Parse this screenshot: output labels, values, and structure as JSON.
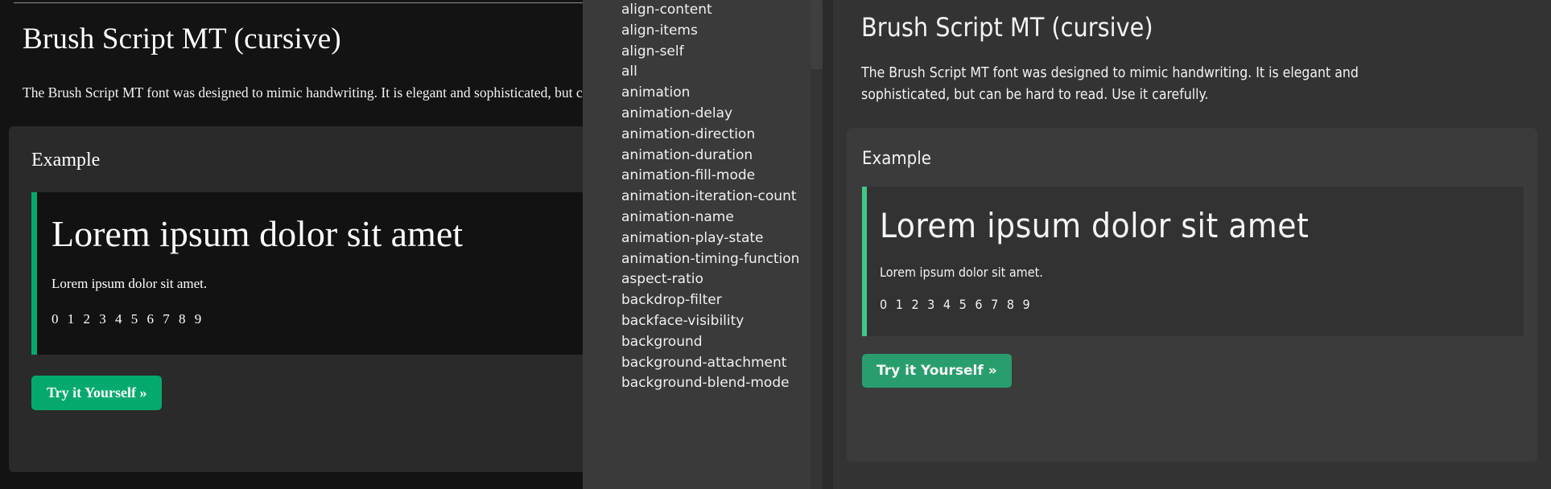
{
  "left_panel": {
    "heading": "Brush Script MT (cursive)",
    "intro": "The Brush Script MT font was designed to mimic handwriting. It is elegant and sophisticated, but can be hard to read. Use it carefully.",
    "example_label": "Example",
    "sample_heading": "Lorem ipsum dolor sit amet",
    "sample_paragraph": "Lorem ipsum dolor sit amet.",
    "sample_numbers": "0 1 2 3 4 5 6 7 8 9",
    "try_button": "Try it Yourself »"
  },
  "property_list": {
    "items": [
      "align-content",
      "align-items",
      "align-self",
      "all",
      "animation",
      "animation-delay",
      "animation-direction",
      "animation-duration",
      "animation-fill-mode",
      "animation-iteration-count",
      "animation-name",
      "animation-play-state",
      "animation-timing-function",
      "aspect-ratio",
      "backdrop-filter",
      "backface-visibility",
      "background",
      "background-attachment",
      "background-blend-mode"
    ]
  },
  "right_panel": {
    "heading": "Brush Script MT (cursive)",
    "intro": "The Brush Script MT font was designed to mimic handwriting. It is elegant and sophisticated, but can be hard to read. Use it carefully.",
    "example_label": "Example",
    "sample_heading": "Lorem ipsum dolor sit amet",
    "sample_paragraph": "Lorem ipsum dolor sit amet.",
    "sample_numbers": "0 1 2 3 4 5 6 7 8 9",
    "try_button": "Try it Yourself »"
  },
  "colors": {
    "accent_green": "#04AA6D",
    "accent_green_light": "#3ec88a",
    "button_green_right": "#2a9d6e",
    "left_bg": "#131313",
    "mid_bg": "#3a3a3a",
    "right_bg": "#333333",
    "card_bg_left": "#2a2a2a",
    "card_bg_right": "#3b3b3b",
    "code_bg_left": "#121212",
    "code_bg_right": "#323232"
  }
}
